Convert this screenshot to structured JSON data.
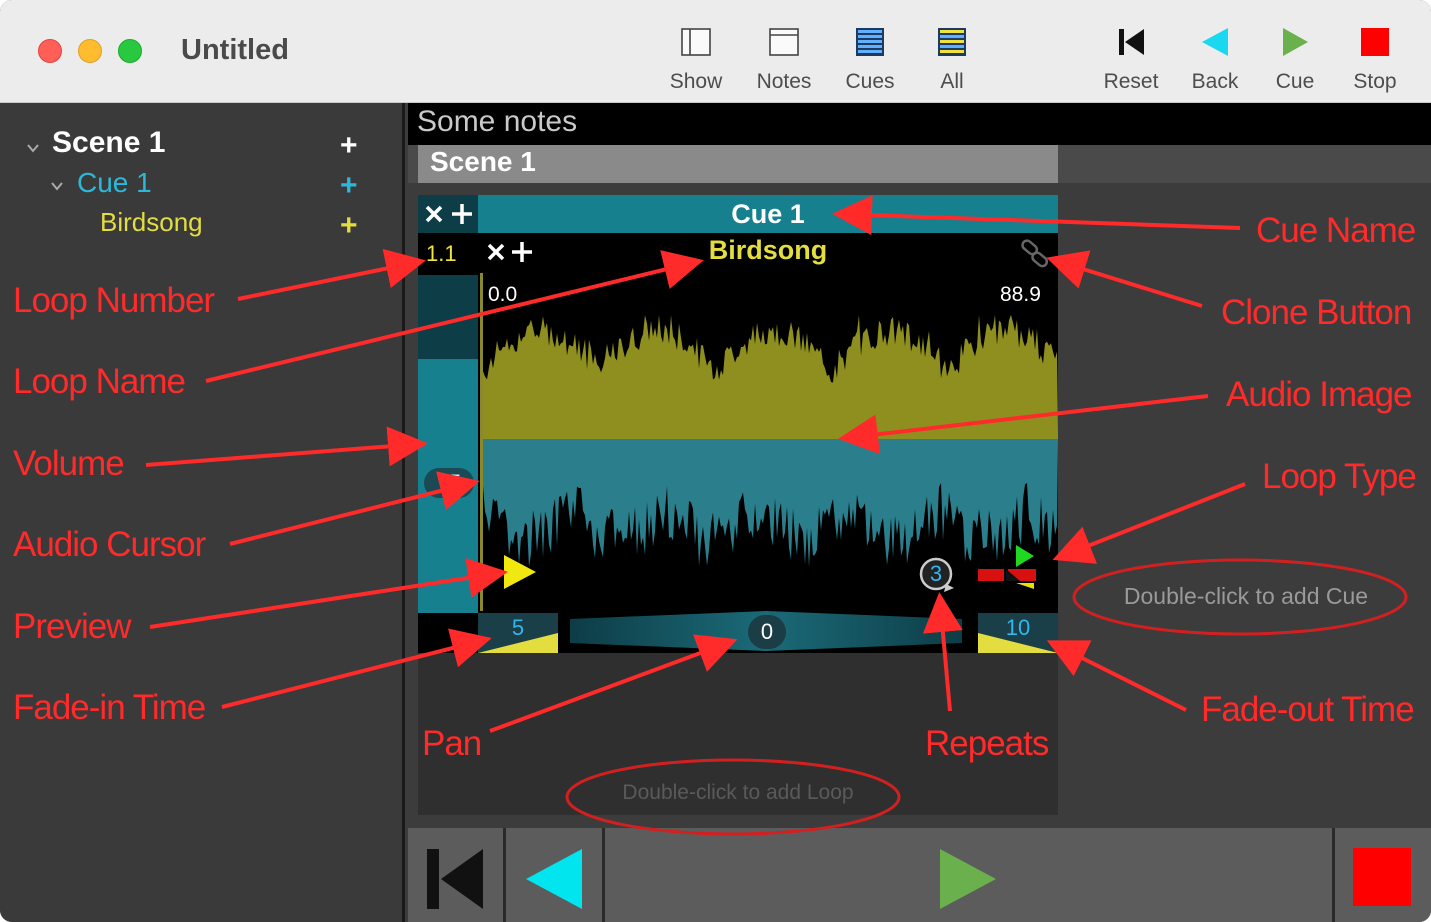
{
  "window": {
    "title": "Untitled"
  },
  "toolbar": {
    "view_buttons": [
      {
        "label": "Show",
        "icon": "show-panel-icon"
      },
      {
        "label": "Notes",
        "icon": "notes-panel-icon"
      },
      {
        "label": "Cues",
        "icon": "cues-panel-icon"
      },
      {
        "label": "All",
        "icon": "all-panels-icon"
      }
    ],
    "transport_buttons": [
      {
        "label": "Reset",
        "icon": "reset-icon"
      },
      {
        "label": "Back",
        "icon": "back-icon"
      },
      {
        "label": "Cue",
        "icon": "play-icon"
      },
      {
        "label": "Stop",
        "icon": "stop-icon"
      }
    ]
  },
  "sidebar": {
    "scene": "Scene 1",
    "cue": "Cue 1",
    "loop": "Birdsong"
  },
  "main": {
    "notes": "Some notes",
    "scene_title": "Scene 1",
    "cue": {
      "name": "Cue 1",
      "loop": {
        "number": "1.1",
        "name": "Birdsong",
        "start_time": "0.0",
        "end_time": "88.9",
        "volume": "75",
        "fade_in": "5",
        "pan": "0",
        "fade_out": "10",
        "repeats": "3"
      }
    },
    "add_loop_hint": "Double-click to add Loop",
    "add_cue_hint": "Double-click to add Cue"
  },
  "annotations": {
    "loop_number": "Loop Number",
    "loop_name": "Loop Name",
    "volume": "Volume",
    "audio_cursor": "Audio Cursor",
    "preview": "Preview",
    "fade_in_time": "Fade-in Time",
    "pan": "Pan",
    "repeats": "Repeats",
    "cue_name": "Cue Name",
    "clone_button": "Clone Button",
    "audio_image": "Audio Image",
    "loop_type": "Loop Type",
    "fade_out_time": "Fade-out Time"
  },
  "colors": {
    "accent_teal": "#17808f",
    "loop_yellow": "#e3dd3f",
    "annotation_red": "#ff2a2a",
    "cyan": "#00e5ee",
    "green": "#6ab04c",
    "stop_red": "#ff0000"
  }
}
